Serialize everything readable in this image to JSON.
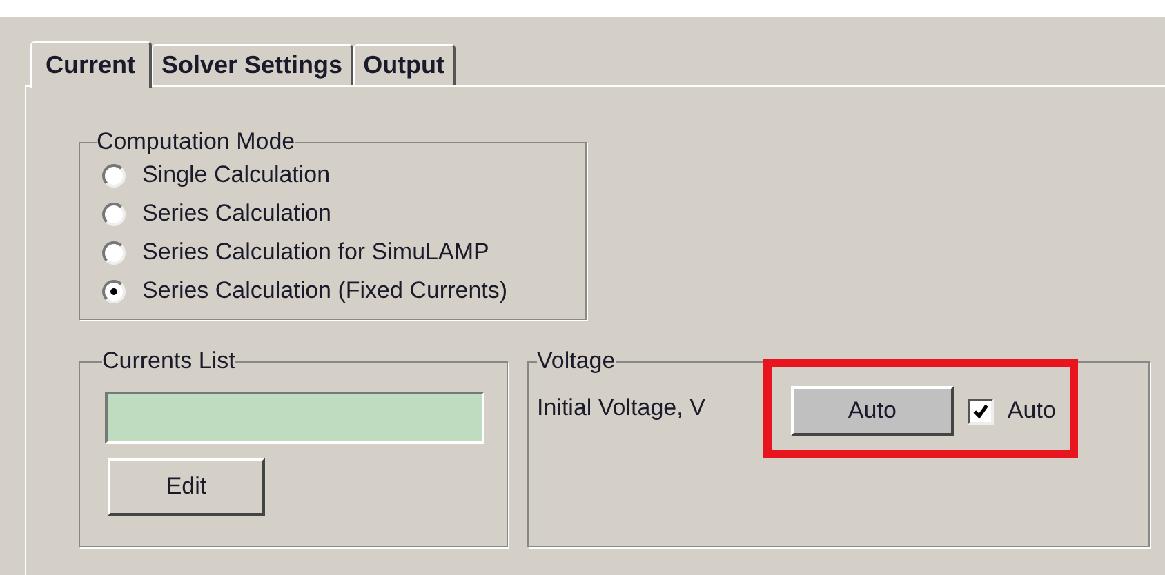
{
  "tabs": [
    {
      "label": "Current",
      "selected": true
    },
    {
      "label": "Solver Settings",
      "selected": false
    },
    {
      "label": "Output",
      "selected": false
    }
  ],
  "computation_mode": {
    "title": "Computation Mode",
    "options": [
      {
        "label": "Single Calculation",
        "selected": false
      },
      {
        "label": "Series Calculation",
        "selected": false
      },
      {
        "label": "Series Calculation for SimuLAMP",
        "selected": false
      },
      {
        "label": "Series Calculation (Fixed Currents)",
        "selected": true
      }
    ]
  },
  "currents_list": {
    "title": "Currents List",
    "button": "Edit"
  },
  "voltage": {
    "title": "Voltage",
    "label": "Initial Voltage, V",
    "button": "Auto",
    "checkbox": {
      "label": "Auto",
      "checked": true
    }
  }
}
